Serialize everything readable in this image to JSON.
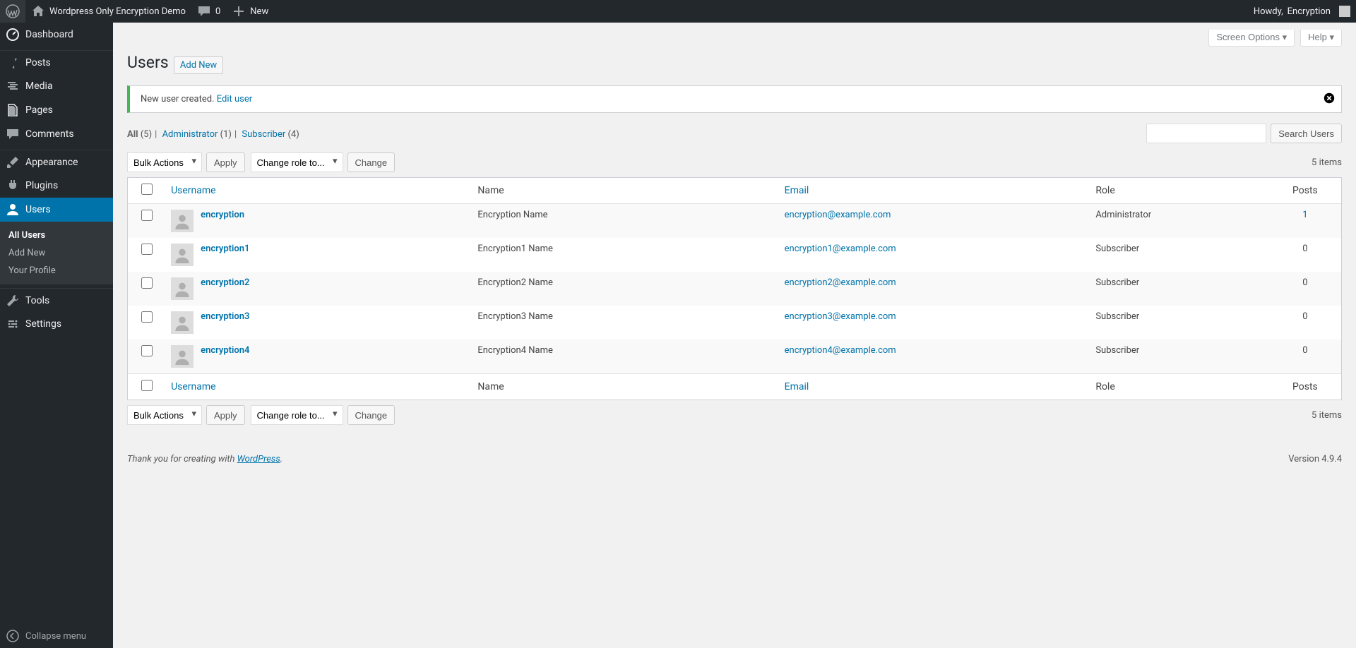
{
  "adminbar": {
    "site_title": "Wordpress Only Encryption Demo",
    "comments_count": "0",
    "new_label": "New",
    "howdy_prefix": "Howdy, ",
    "user_name": "Encryption"
  },
  "sidebar": {
    "items": [
      {
        "id": "dashboard",
        "label": "Dashboard",
        "icon": "dashboard"
      },
      {
        "id": "posts",
        "label": "Posts",
        "icon": "pin"
      },
      {
        "id": "media",
        "label": "Media",
        "icon": "media"
      },
      {
        "id": "pages",
        "label": "Pages",
        "icon": "pages"
      },
      {
        "id": "comments",
        "label": "Comments",
        "icon": "comment"
      },
      {
        "id": "appearance",
        "label": "Appearance",
        "icon": "brush"
      },
      {
        "id": "plugins",
        "label": "Plugins",
        "icon": "plug"
      },
      {
        "id": "users",
        "label": "Users",
        "icon": "user"
      },
      {
        "id": "tools",
        "label": "Tools",
        "icon": "wrench"
      },
      {
        "id": "settings",
        "label": "Settings",
        "icon": "settings"
      }
    ],
    "submenu_users": [
      {
        "label": "All Users",
        "current": true
      },
      {
        "label": "Add New",
        "current": false
      },
      {
        "label": "Your Profile",
        "current": false
      }
    ],
    "collapse_label": "Collapse menu"
  },
  "screen_meta": {
    "screen_options": "Screen Options",
    "help": "Help"
  },
  "header": {
    "title": "Users",
    "add_new": "Add New"
  },
  "notice": {
    "text": "New user created. ",
    "link_text": "Edit user"
  },
  "filters": {
    "all_label": "All",
    "all_count": "(5)",
    "admin_label": "Administrator",
    "admin_count": "(1)",
    "sub_label": "Subscriber",
    "sub_count": "(4)"
  },
  "search": {
    "button": "Search Users"
  },
  "bulk": {
    "bulk_actions": "Bulk Actions",
    "apply": "Apply",
    "change_role": "Change role to...",
    "change": "Change"
  },
  "item_count": "5 items",
  "columns": {
    "username": "Username",
    "name": "Name",
    "email": "Email",
    "role": "Role",
    "posts": "Posts"
  },
  "users": [
    {
      "username": "encryption",
      "name": "Encryption Name",
      "email": "encryption@example.com",
      "role": "Administrator",
      "posts": "1"
    },
    {
      "username": "encryption1",
      "name": "Encryption1 Name",
      "email": "encryption1@example.com",
      "role": "Subscriber",
      "posts": "0"
    },
    {
      "username": "encryption2",
      "name": "Encryption2 Name",
      "email": "encryption2@example.com",
      "role": "Subscriber",
      "posts": "0"
    },
    {
      "username": "encryption3",
      "name": "Encryption3 Name",
      "email": "encryption3@example.com",
      "role": "Subscriber",
      "posts": "0"
    },
    {
      "username": "encryption4",
      "name": "Encryption4 Name",
      "email": "encryption4@example.com",
      "role": "Subscriber",
      "posts": "0"
    }
  ],
  "footer": {
    "thank_you": "Thank you for creating with ",
    "wp_link": "WordPress",
    "period": ".",
    "version": "Version 4.9.4"
  }
}
